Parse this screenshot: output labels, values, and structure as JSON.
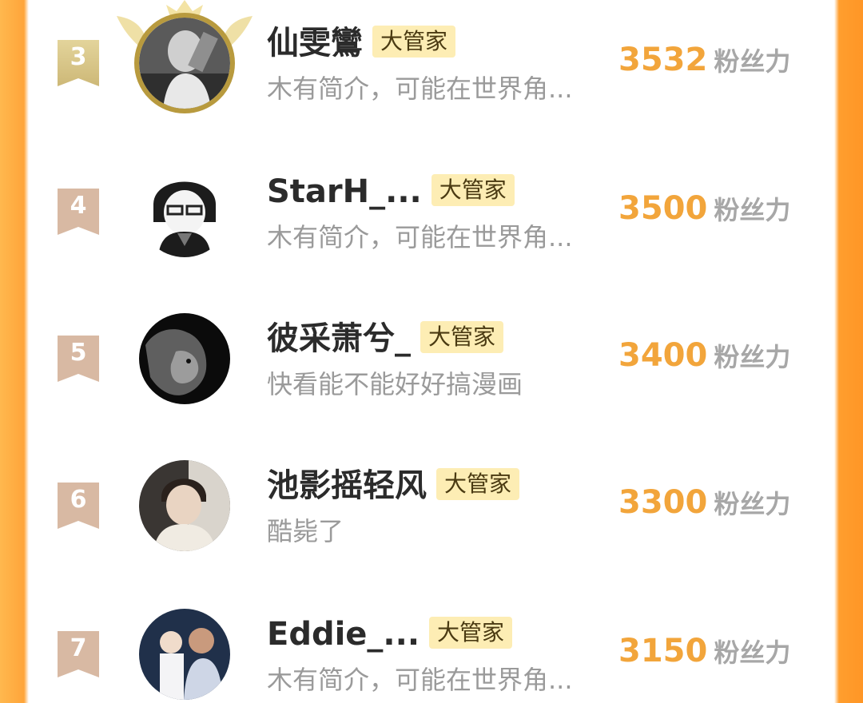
{
  "colors": {
    "score": "#f2a53b",
    "tag_bg": "#fdedb4",
    "badge_top3": "#d8c585",
    "badge_other": "#d8b9a3",
    "frame": "#ffa53a"
  },
  "ranking": [
    {
      "rank": "3",
      "name": "仙雯鸞",
      "tag": "大管家",
      "bio": "木有简介，可能在世界角...",
      "score": "3532",
      "unit": "粉丝力",
      "avatar_icon": "person-photo-icon",
      "top3": true
    },
    {
      "rank": "4",
      "name": "StarH_...",
      "tag": "大管家",
      "bio": "木有简介，可能在世界角...",
      "score": "3500",
      "unit": "粉丝力",
      "avatar_icon": "anime-character-icon",
      "top3": false
    },
    {
      "rank": "5",
      "name": "彼采萧兮_",
      "tag": "大管家",
      "bio": "快看能不能好好搞漫画",
      "score": "3400",
      "unit": "粉丝力",
      "avatar_icon": "lion-icon",
      "top3": false
    },
    {
      "rank": "6",
      "name": "池影摇轻风",
      "tag": "大管家",
      "bio": "酷毙了",
      "score": "3300",
      "unit": "粉丝力",
      "avatar_icon": "person-photo-icon",
      "top3": false
    },
    {
      "rank": "7",
      "name": "Eddie_...",
      "tag": "大管家",
      "bio": "木有简介，可能在世界角...",
      "score": "3150",
      "unit": "粉丝力",
      "avatar_icon": "family-photo-icon",
      "top3": false
    }
  ]
}
